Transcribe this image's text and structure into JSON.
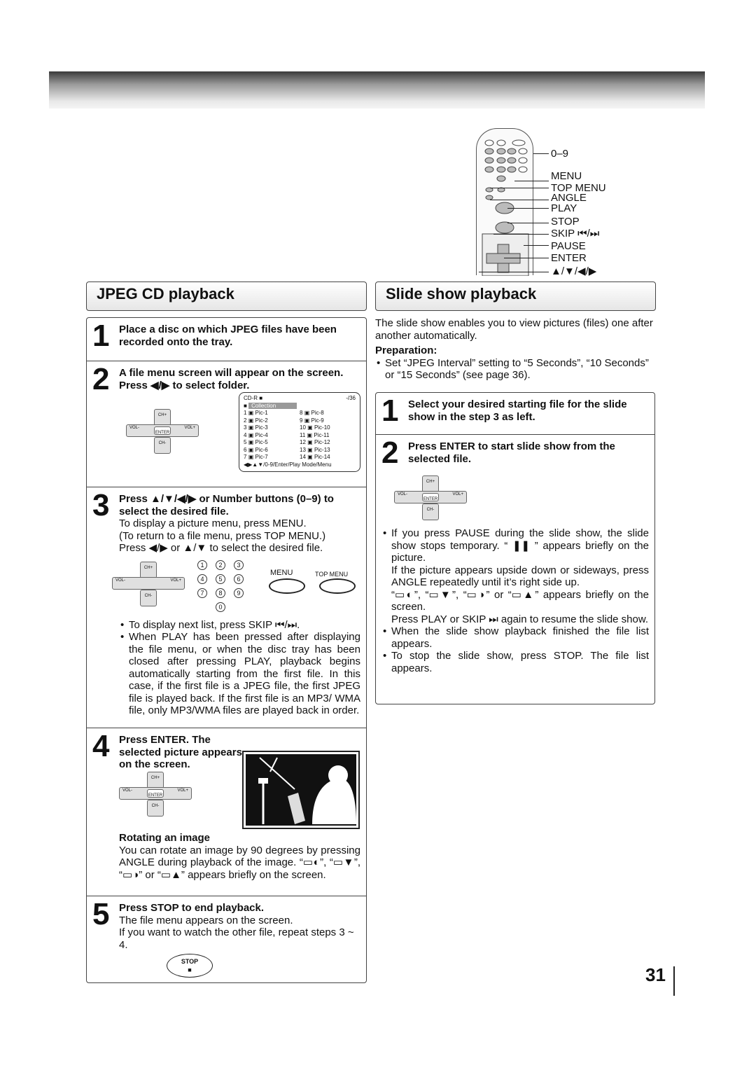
{
  "remote": {
    "labels": [
      "0–9",
      "MENU",
      "TOP MENU",
      "ANGLE",
      "PLAY",
      "STOP",
      "SKIP ⏮/⏭",
      "PAUSE",
      "ENTER",
      "▲/▼/◀/▶"
    ]
  },
  "left": {
    "title": "JPEG CD playback",
    "steps": [
      {
        "num": "1",
        "head": "Place a disc on which JPEG files have been recorded onto the tray."
      },
      {
        "num": "2",
        "head": "A file menu screen will appear on the screen. Press ◀/▶ to select folder."
      },
      {
        "num": "3",
        "head": "Press ▲/▼/◀/▶ or Number buttons (0–9) to select the desired file.",
        "body": [
          "To display a picture menu, press MENU.",
          "(To return to a file menu, press TOP MENU.)",
          "Press ◀/▶ or ▲/▼ to select the desired file."
        ],
        "bullets": [
          "To display next list, press SKIP ⏮/⏭.",
          "When PLAY has been pressed after displaying the file menu, or when the disc tray has been closed after pressing PLAY, playback begins automatically starting from the first file. In this case, if the first file is a JPEG file, the first JPEG file is played back. If the first file is an MP3/ WMA file, only MP3/WMA files are played back in order."
        ]
      },
      {
        "num": "4",
        "head": "Press ENTER. The selected picture appears on the screen.",
        "subhead": "Rotating an image",
        "body": "You can rotate an image by 90 degrees by pressing ANGLE during playback of the image. “▭◐”, “▭▼”, “▭◑” or “▭▲” appears briefly on the screen."
      },
      {
        "num": "5",
        "head": "Press STOP to end playback.",
        "body": [
          "The file menu appears on the screen.",
          "If you want to watch the other file, repeat steps 3 ~ 4."
        ]
      }
    ],
    "file_menu": {
      "disc": "CD-R ■",
      "count": "-/36",
      "folder": "Collection",
      "files": [
        "Pic-1",
        "Pic-2",
        "Pic-3",
        "Pic-4",
        "Pic-5",
        "Pic-6",
        "Pic-7",
        "Pic-8",
        "Pic-9",
        "Pic-10",
        "Pic-11",
        "Pic-12",
        "Pic-13",
        "Pic-14"
      ],
      "footer": "◀▶▲▼/0-9/Enter/Play Mode/Menu"
    },
    "dpad": {
      "up": "CH+",
      "down": "CH-",
      "left": "VOL-",
      "right": "VOL+",
      "center": "ENTER"
    },
    "buttons": {
      "menu": "MENU",
      "top_menu": "TOP MENU",
      "stop": "STOP",
      "numbers": [
        "1",
        "2",
        "3",
        "4",
        "5",
        "6",
        "7",
        "8",
        "9",
        "0"
      ]
    }
  },
  "right": {
    "title": "Slide show playback",
    "intro": "The slide show enables you to view pictures (files) one after another automatically.",
    "prep_head": "Preparation:",
    "prep": "Set “JPEG Interval” setting to “5 Seconds”, “10 Seconds” or “15 Seconds” (see page 36).",
    "steps": [
      {
        "num": "1",
        "head": "Select your desired starting file for the slide show in the step 3 as left."
      },
      {
        "num": "2",
        "head": "Press ENTER to start slide show from the selected file."
      }
    ],
    "bullets": [
      "If you press PAUSE during the slide show, the slide show stops temporary. “ ❚❚ ” appears briefly on the picture.",
      "If the picture appears upside down or sideways, press ANGLE repeatedly until it’s right side up.",
      "“▭◐”, “▭▼”, “▭◑” or “▭▲” appears briefly on the screen.",
      "Press PLAY or SKIP ⏭ again to resume the slide show.",
      "When the slide show playback finished the file list appears.",
      "To stop the slide show, press STOP. The file list appears."
    ]
  },
  "page_number": "31"
}
